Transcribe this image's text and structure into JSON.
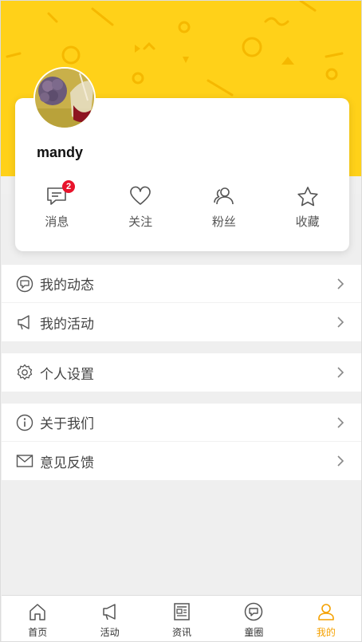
{
  "profile": {
    "username": "mandy",
    "stats": [
      {
        "key": "messages",
        "label": "消息",
        "icon": "message-icon",
        "badge": "2"
      },
      {
        "key": "following",
        "label": "关注",
        "icon": "heart-icon"
      },
      {
        "key": "fans",
        "label": "粉丝",
        "icon": "users-icon"
      },
      {
        "key": "favorites",
        "label": "收藏",
        "icon": "star-icon"
      }
    ]
  },
  "menu": {
    "group1": [
      {
        "label": "我的动态",
        "icon": "chat-bubble-icon"
      },
      {
        "label": "我的活动",
        "icon": "megaphone-icon"
      }
    ],
    "group2": [
      {
        "label": "个人设置",
        "icon": "gear-icon"
      }
    ],
    "group3": [
      {
        "label": "关于我们",
        "icon": "info-icon"
      },
      {
        "label": "意见反馈",
        "icon": "mail-icon"
      }
    ]
  },
  "tabbar": [
    {
      "label": "首页",
      "icon": "home-icon"
    },
    {
      "label": "活动",
      "icon": "megaphone-icon"
    },
    {
      "label": "资讯",
      "icon": "news-icon"
    },
    {
      "label": "童圈",
      "icon": "chat-bubble-icon"
    },
    {
      "label": "我的",
      "icon": "user-icon",
      "active": true
    }
  ],
  "colors": {
    "hero": "#ffd119",
    "accent": "#f5a100",
    "badge": "#e8132b"
  }
}
